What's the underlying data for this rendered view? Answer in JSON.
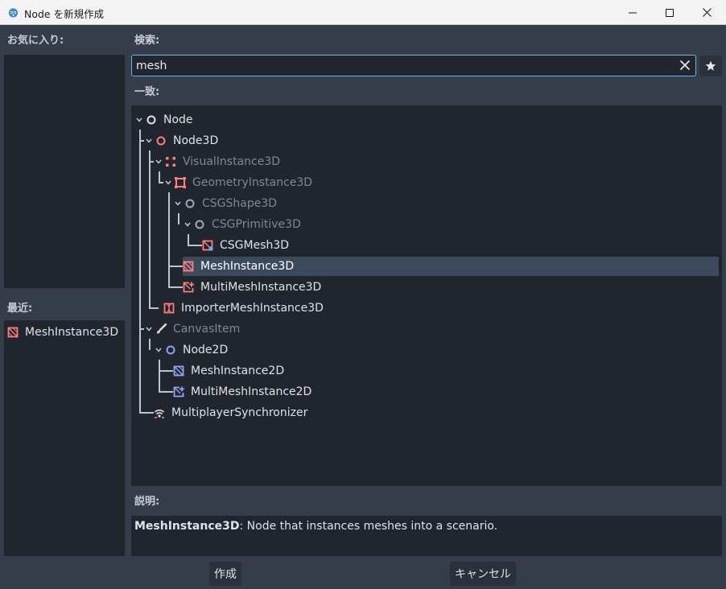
{
  "window": {
    "title": "Node を新規作成",
    "icon": "godot-icon",
    "controls": [
      "minimize-icon",
      "maximize-icon",
      "close-icon"
    ]
  },
  "favorites": {
    "label": "お気に入り:",
    "items": []
  },
  "recent": {
    "label": "最近:",
    "items": [
      {
        "name": "MeshInstance3D",
        "icon": "mesh-instance-3d-icon"
      }
    ]
  },
  "search": {
    "label": "検索:",
    "value": "mesh",
    "placeholder": ""
  },
  "matches": {
    "label": "一致:",
    "tree": [
      {
        "name": "Node",
        "icon": "node-icon",
        "dimmed": false,
        "expanded": true
      },
      {
        "name": "Node3D",
        "icon": "node3d-icon",
        "dimmed": false,
        "expanded": true
      },
      {
        "name": "VisualInstance3D",
        "icon": "visual-instance-3d-icon",
        "dimmed": true,
        "expanded": true
      },
      {
        "name": "GeometryInstance3D",
        "icon": "geometry-instance-3d-icon",
        "dimmed": true,
        "expanded": true
      },
      {
        "name": "CSGShape3D",
        "icon": "csg-shape-3d-icon",
        "dimmed": true,
        "expanded": true
      },
      {
        "name": "CSGPrimitive3D",
        "icon": "csg-primitive-3d-icon",
        "dimmed": true,
        "expanded": true
      },
      {
        "name": "CSGMesh3D",
        "icon": "csg-mesh-3d-icon",
        "dimmed": false
      },
      {
        "name": "MeshInstance3D",
        "icon": "mesh-instance-3d-icon",
        "dimmed": false,
        "selected": true
      },
      {
        "name": "MultiMeshInstance3D",
        "icon": "multimesh-instance-3d-icon",
        "dimmed": false
      },
      {
        "name": "ImporterMeshInstance3D",
        "icon": "importer-mesh-instance-3d-icon",
        "dimmed": false
      },
      {
        "name": "CanvasItem",
        "icon": "canvas-item-icon",
        "dimmed": true,
        "expanded": true
      },
      {
        "name": "Node2D",
        "icon": "node2d-icon",
        "dimmed": false,
        "expanded": true
      },
      {
        "name": "MeshInstance2D",
        "icon": "mesh-instance-2d-icon",
        "dimmed": false
      },
      {
        "name": "MultiMeshInstance2D",
        "icon": "multimesh-instance-2d-icon",
        "dimmed": false
      },
      {
        "name": "MultiplayerSynchronizer",
        "icon": "multiplayer-synchronizer-icon",
        "dimmed": false
      }
    ]
  },
  "description": {
    "label": "説明:",
    "class_name": "MeshInstance3D",
    "text": ": Node that instances meshes into a scenario."
  },
  "buttons": {
    "create": "作成",
    "cancel": "キャンセル"
  },
  "colors": {
    "background": "#363d4a",
    "panel": "#21252d",
    "accent": "#6fb2e8",
    "selection": "#3b4a5c",
    "node3d_red": "#fc7f7f",
    "node2d_blue": "#8da5f3"
  }
}
